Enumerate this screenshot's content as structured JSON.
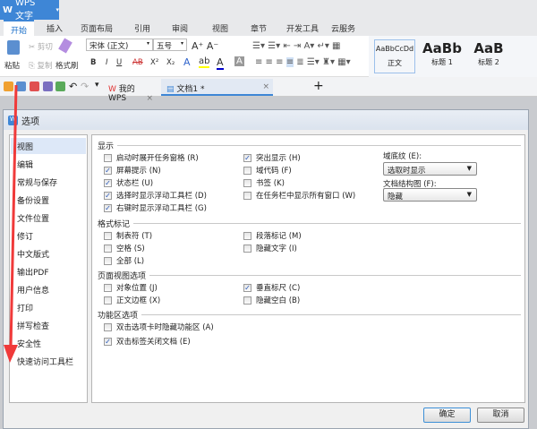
{
  "app": {
    "title": "WPS 文字"
  },
  "tabs": [
    "开始",
    "插入",
    "页面布局",
    "引用",
    "审阅",
    "视图",
    "章节",
    "开发工具",
    "云服务"
  ],
  "ribbon": {
    "paste": "粘贴",
    "cut": "剪切",
    "copy": "复制",
    "format_painter": "格式刷",
    "font": "宋体 (正文)",
    "size": "五号",
    "bold": "B",
    "italic": "I",
    "underline": "U",
    "strike": "AB",
    "sup": "X²",
    "sub": "X₂",
    "styles": [
      {
        "preview": "AaBbCcDd",
        "name": "正文"
      },
      {
        "preview": "AaBb",
        "name": "标题 1"
      },
      {
        "preview": "AaB",
        "name": "标题 2"
      }
    ]
  },
  "doc_tabs": [
    {
      "label": "我的WPS"
    },
    {
      "label": "文档1 *"
    }
  ],
  "dialog": {
    "title": "选项",
    "categories": [
      "视图",
      "编辑",
      "常规与保存",
      "备份设置",
      "文件位置",
      "修订",
      "中文版式",
      "输出PDF",
      "用户信息",
      "打印",
      "拼写检查",
      "安全性",
      "快速访问工具栏"
    ],
    "sections": [
      {
        "title": "显示",
        "items": [
          {
            "label": "启动时展开任务窗格 (R)",
            "checked": false
          },
          {
            "label": "突出显示 (H)",
            "checked": true
          },
          {
            "label": "屏幕提示 (N)",
            "checked": true
          },
          {
            "label": "域代码 (F)",
            "checked": false
          },
          {
            "label": "状态栏 (U)",
            "checked": true
          },
          {
            "label": "书签 (K)",
            "checked": false
          },
          {
            "label": "选择时显示浮动工具栏 (D)",
            "checked": true
          },
          {
            "label": "在任务栏中显示所有窗口 (W)",
            "checked": false
          },
          {
            "label": "右键时显示浮动工具栏 (G)",
            "checked": true
          }
        ]
      },
      {
        "title": "格式标记",
        "items": [
          {
            "label": "制表符 (T)",
            "checked": false
          },
          {
            "label": "段落标记 (M)",
            "checked": false
          },
          {
            "label": "空格 (S)",
            "checked": false
          },
          {
            "label": "隐藏文字 (I)",
            "checked": false
          },
          {
            "label": "全部 (L)",
            "checked": false
          }
        ]
      },
      {
        "title": "页面视图选项",
        "items": [
          {
            "label": "对象位置 (J)",
            "checked": false
          },
          {
            "label": "垂直标尺 (C)",
            "checked": true
          },
          {
            "label": "正文边框 (X)",
            "checked": false
          },
          {
            "label": "隐藏空白 (B)",
            "checked": false
          }
        ]
      },
      {
        "title": "功能区选项",
        "items": [
          {
            "label": "双击选项卡时隐藏功能区 (A)",
            "checked": false
          },
          {
            "label": "双击标签关闭文档 (E)",
            "checked": true
          }
        ]
      }
    ],
    "field_shading": {
      "label": "域底纹 (E):",
      "value": "选取时显示"
    },
    "doc_map": {
      "label": "文档结构图 (F):",
      "value": "隐藏"
    },
    "ok": "确定",
    "cancel": "取消"
  },
  "colors": {
    "accent": "#3e86d6",
    "arrow": "#f03a3a"
  }
}
